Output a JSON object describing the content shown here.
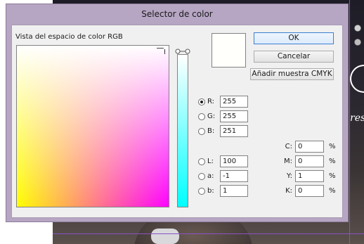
{
  "dialog": {
    "title": "Selector de color",
    "space_label": "Vista del espacio de color RGB",
    "buttons": {
      "ok": "OK",
      "cancel": "Cancelar",
      "add_swatch": "Añadir muestra CMYK"
    },
    "preview_color": "#fffffb",
    "rgb": [
      {
        "label": "R:",
        "value": "255",
        "checked": true
      },
      {
        "label": "G:",
        "value": "255",
        "checked": false
      },
      {
        "label": "B:",
        "value": "251",
        "checked": false
      }
    ],
    "lab": [
      {
        "label": "L:",
        "value": "100",
        "checked": false
      },
      {
        "label": "a:",
        "value": "-1",
        "checked": false
      },
      {
        "label": "b:",
        "value": "1",
        "checked": false
      }
    ],
    "cmyk": [
      {
        "label": "C:",
        "value": "0",
        "unit": "%"
      },
      {
        "label": "M:",
        "value": "0",
        "unit": "%"
      },
      {
        "label": "Y:",
        "value": "1",
        "unit": "%"
      },
      {
        "label": "K:",
        "value": "0",
        "unit": "%"
      }
    ]
  },
  "background": {
    "partial_text": "res"
  }
}
